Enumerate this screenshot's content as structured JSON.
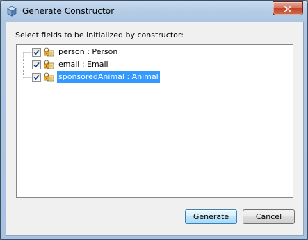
{
  "window": {
    "title": "Generate Constructor",
    "icon": "netbeans-cube-icon",
    "close_icon": "close-icon"
  },
  "dialog": {
    "prompt": "Select fields to be initialized by constructor:",
    "fields": [
      {
        "label": "person : Person",
        "checked": true,
        "selected": false,
        "icon": "private-field-lock-icon"
      },
      {
        "label": "email : Email",
        "checked": true,
        "selected": false,
        "icon": "private-field-lock-icon"
      },
      {
        "label": "sponsoredAnimal : Animal",
        "checked": true,
        "selected": true,
        "icon": "private-field-lock-icon"
      }
    ]
  },
  "buttons": {
    "generate": "Generate",
    "cancel": "Cancel"
  },
  "colors": {
    "selection": "#3399ff",
    "titlebar": "#b6cde6",
    "close": "#c3432a"
  }
}
